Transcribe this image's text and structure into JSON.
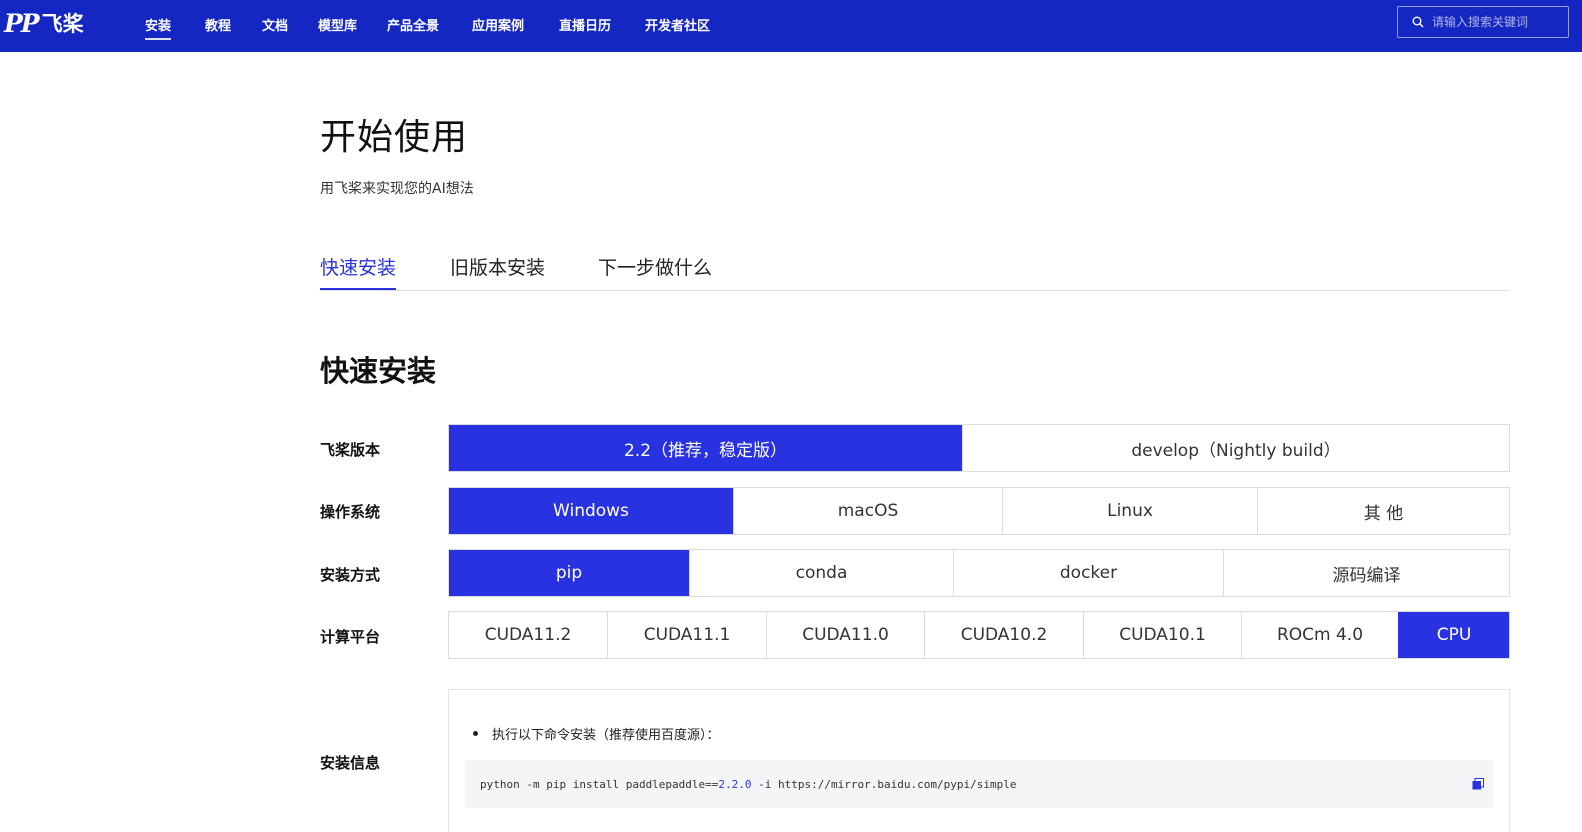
{
  "brand": {
    "logo_mark": "PP",
    "logo_text": "飞桨"
  },
  "nav": {
    "items": [
      {
        "label": "安装",
        "active": true
      },
      {
        "label": "教程"
      },
      {
        "label": "文档"
      },
      {
        "label": "模型库"
      },
      {
        "label": "产品全景"
      },
      {
        "label": "应用案例"
      },
      {
        "label": "直播日历"
      },
      {
        "label": "开发者社区"
      }
    ],
    "search_placeholder": "请输入搜索关键词",
    "search_icon": "search-icon"
  },
  "page": {
    "title": "开始使用",
    "subtitle": "用飞桨来实现您的AI想法"
  },
  "tabs": [
    {
      "label": "快速安装",
      "active": true
    },
    {
      "label": "旧版本安装"
    },
    {
      "label": "下一步做什么"
    }
  ],
  "section_title": "快速安装",
  "selectors": {
    "version": {
      "label": "飞桨版本",
      "options": [
        "2.2（推荐，稳定版）",
        "develop（Nightly build）"
      ],
      "selected": "2.2（推荐，稳定版）"
    },
    "os": {
      "label": "操作系统",
      "options": [
        "Windows",
        "macOS",
        "Linux",
        "其 他"
      ],
      "selected": "Windows"
    },
    "method": {
      "label": "安装方式",
      "options": [
        "pip",
        "conda",
        "docker",
        "源码编译"
      ],
      "selected": "pip"
    },
    "platform": {
      "label": "计算平台",
      "options": [
        "CUDA11.2",
        "CUDA11.1",
        "CUDA11.0",
        "CUDA10.2",
        "CUDA10.1",
        "ROCm 4.0",
        "CPU"
      ],
      "selected": "CPU"
    }
  },
  "install_info": {
    "label": "安装信息",
    "instruction": "执行以下命令安装（推荐使用百度源）：",
    "command_prefix": "python -m pip install paddlepaddle==",
    "command_version": "2.2.0",
    "command_suffix": " -i https://mirror.baidu.com/pypi/simple",
    "copy_icon": "copy-icon"
  },
  "colors": {
    "nav_bg": "#1527c2",
    "accent": "#2932e1"
  }
}
